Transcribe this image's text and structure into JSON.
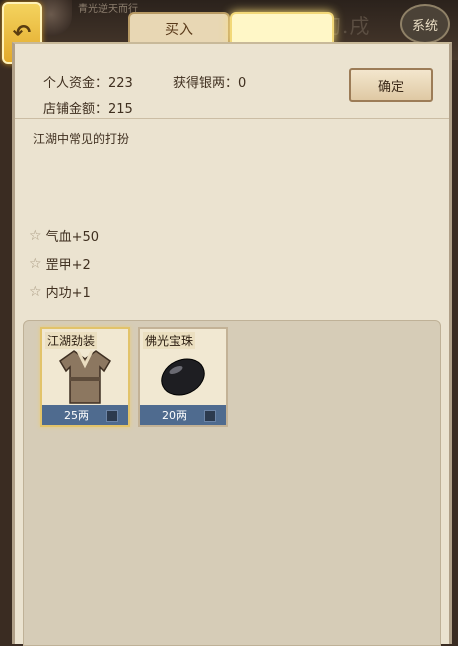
{
  "header": {
    "faded_caption": "青光逆天而行",
    "time_text": "酉初.戌",
    "back_icon": "back-arrow-icon",
    "system_label": "系统"
  },
  "tabs": {
    "buy_label": "买入",
    "sell_label": ""
  },
  "stats": {
    "personal_funds": "个人资金：223",
    "silver_gained": "获得银两：0",
    "shop_funds": "店铺金额：215"
  },
  "confirm_label": "确定",
  "description": "江湖中常见的打扮",
  "attributes": [
    {
      "label": "气血+50"
    },
    {
      "label": "罡甲+2"
    },
    {
      "label": "内功+1"
    }
  ],
  "items": [
    {
      "name": "江湖劲装",
      "price": "25两",
      "icon": "robe-icon",
      "selected": true
    },
    {
      "name": "佛光宝珠",
      "price": "20两",
      "icon": "black-orb-icon",
      "selected": false
    }
  ],
  "colors": {
    "accent_gold": "#e2a92b",
    "price_bar": "#4f6b8f",
    "panel_bg": "#ebe3d0"
  }
}
